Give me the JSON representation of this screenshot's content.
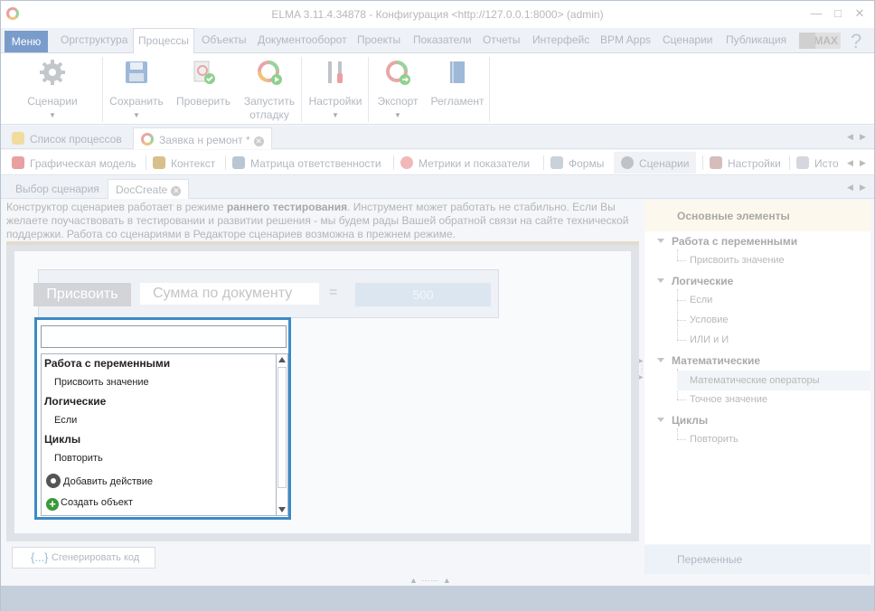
{
  "window": {
    "title": "ELMA 3.11.4.34878 - Конфигурация <http://127.0.0.1:8000> (admin)"
  },
  "menubar": {
    "menu_label": "Меню",
    "tabs": [
      "Оргструктура",
      "Процессы",
      "Объекты",
      "Документооборот",
      "Проекты",
      "Показатели",
      "Отчеты",
      "Интерфейс",
      "BPM Apps",
      "Сценарии",
      "Публикация"
    ],
    "active_tab": "Процессы",
    "max_label": "MAX"
  },
  "ribbon": {
    "buttons": [
      {
        "label": "Сценарии",
        "icon": "gear-icon"
      },
      {
        "label": "Сохранить",
        "icon": "save-icon"
      },
      {
        "label": "Проверить",
        "icon": "check-icon"
      },
      {
        "label": "Запустить отладку",
        "line1": "Запустить",
        "line2": "отладку",
        "icon": "debug-icon"
      },
      {
        "label": "Настройки",
        "icon": "tools-icon"
      },
      {
        "label": "Экспорт",
        "icon": "export-icon"
      },
      {
        "label": "Регламент",
        "icon": "book-icon"
      }
    ]
  },
  "doctabs": {
    "tabs": [
      "Список процессов",
      "Заявка н ремонт *"
    ]
  },
  "modeltabs": {
    "tabs": [
      "Графическая модель",
      "Контекст",
      "Матрица ответственности",
      "Метрики и показатели",
      "Формы",
      "Сценарии",
      "Настройки",
      "Исто"
    ],
    "active": "Сценарии"
  },
  "subtabs": {
    "tabs": [
      "Выбор сценария",
      "DocCreate"
    ]
  },
  "warning": {
    "part1": "Конструктор сценариев работает в режиме ",
    "bold": "раннего тестирования",
    "part2": ". Инструмент может работать не стабильно. Если Вы желаете поучаствовать в тестировании и развитии решения - мы будем рады Вашей обратной связи на сайте технической поддержки. Работа со сценариями в Редакторе сценариев возможна в прежнем режиме."
  },
  "canvas": {
    "assign_label": "Присвоить",
    "sum_field": "Сумма по документу",
    "equals": "=",
    "value": "500"
  },
  "popup": {
    "search_value": "",
    "groups": [
      {
        "title": "Работа с переменными",
        "items": [
          "Присвоить значение"
        ]
      },
      {
        "title": "Логические",
        "items": [
          "Если"
        ]
      },
      {
        "title": "Циклы",
        "items": [
          "Повторить"
        ]
      }
    ],
    "add_action": "Добавить действие",
    "create_object": "Создать объект"
  },
  "generate_button": "Сгенерировать код",
  "right_panel": {
    "header": "Основные элементы",
    "groups": [
      {
        "title": "Работа с переменными",
        "items": [
          "Присвоить значение"
        ]
      },
      {
        "title": "Логические",
        "items": [
          "Если",
          "Условие",
          "ИЛИ и И"
        ]
      },
      {
        "title": "Математические",
        "items": [
          "Математические операторы",
          "Точное значение"
        ]
      },
      {
        "title": "Циклы",
        "items": [
          "Повторить"
        ]
      }
    ],
    "selected_item": "Математические операторы",
    "bottom": "Переменные"
  },
  "colors": {
    "accent": "#3c8ac6",
    "menu_button": "#7a9ccb",
    "status_bar": "#c5cfdc"
  }
}
